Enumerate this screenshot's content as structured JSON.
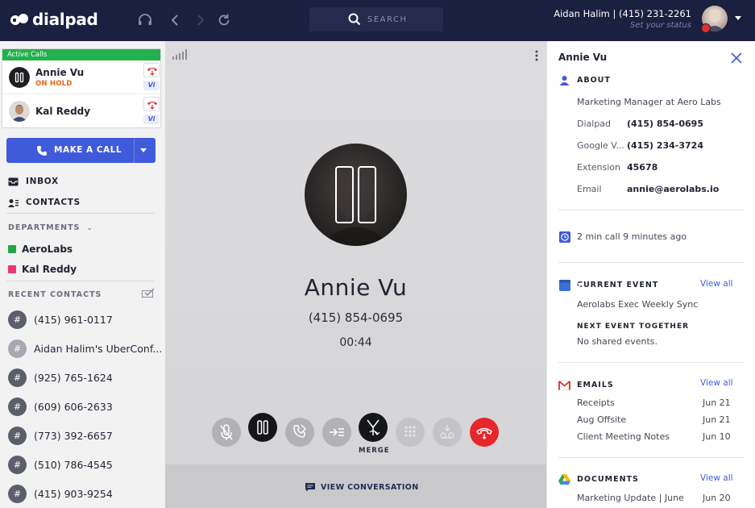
{
  "topbar": {
    "logo_text": "dialpad",
    "search_placeholder": "SEARCH",
    "user_name": "Aidan Halim | (415) 231-2261",
    "user_status": "Set your status"
  },
  "sidebar": {
    "active_calls_label": "Active Calls",
    "calls": [
      {
        "name": "Annie Vu",
        "status": "ON HOLD",
        "vi": "Vi"
      },
      {
        "name": "Kal Reddy",
        "status": "",
        "vi": "Vi"
      }
    ],
    "make_call_label": "MAKE A CALL",
    "inbox_label": "INBOX",
    "contacts_label": "CONTACTS",
    "departments_label": "DEPARTMENTS",
    "departments": [
      {
        "name": "AeroLabs",
        "color": "#1fa84a"
      },
      {
        "name": "Kal Reddy",
        "color": "#e8376a"
      }
    ],
    "recent_contacts_label": "RECENT CONTACTS",
    "recent_contacts": [
      "(415) 961-0117",
      "Aidan Halim's UberConf...",
      "(925) 765-1624",
      "(609) 606-2633",
      "(773) 392-6657",
      "(510) 786-4545",
      "(415) 903-9254"
    ]
  },
  "call": {
    "name": "Annie Vu",
    "number": "(415) 854-0695",
    "duration": "00:44",
    "merge_label": "MERGE",
    "view_conversation_label": "VIEW CONVERSATION"
  },
  "panel": {
    "name": "Annie Vu",
    "about_label": "ABOUT",
    "title": "Marketing Manager at Aero Labs",
    "fields": [
      {
        "key": "Dialpad",
        "value": "(415) 854-0695"
      },
      {
        "key": "Google V...",
        "value": "(415) 234-3724"
      },
      {
        "key": "Extension",
        "value": "45678"
      },
      {
        "key": "Email",
        "value": "annie@aerolabs.io"
      }
    ],
    "last_call": "2 min call 9 minutes ago",
    "current_event_label": "CURRENT EVENT",
    "current_event": "Aerolabs Exec Weekly Sync",
    "next_event_label": "NEXT EVENT TOGETHER",
    "next_event": "No shared events.",
    "calendar_day": "31",
    "emails_label": "EMAILS",
    "emails": [
      {
        "subject": "Receipts",
        "date": "Jun 21"
      },
      {
        "subject": "Aug Offsite",
        "date": "Jun 21"
      },
      {
        "subject": "Client Meeting Notes",
        "date": "Jun 10"
      }
    ],
    "documents_label": "DOCUMENTS",
    "documents": [
      {
        "title": "Marketing Update | June",
        "date": "Jun 20"
      }
    ],
    "view_all": "View all"
  }
}
